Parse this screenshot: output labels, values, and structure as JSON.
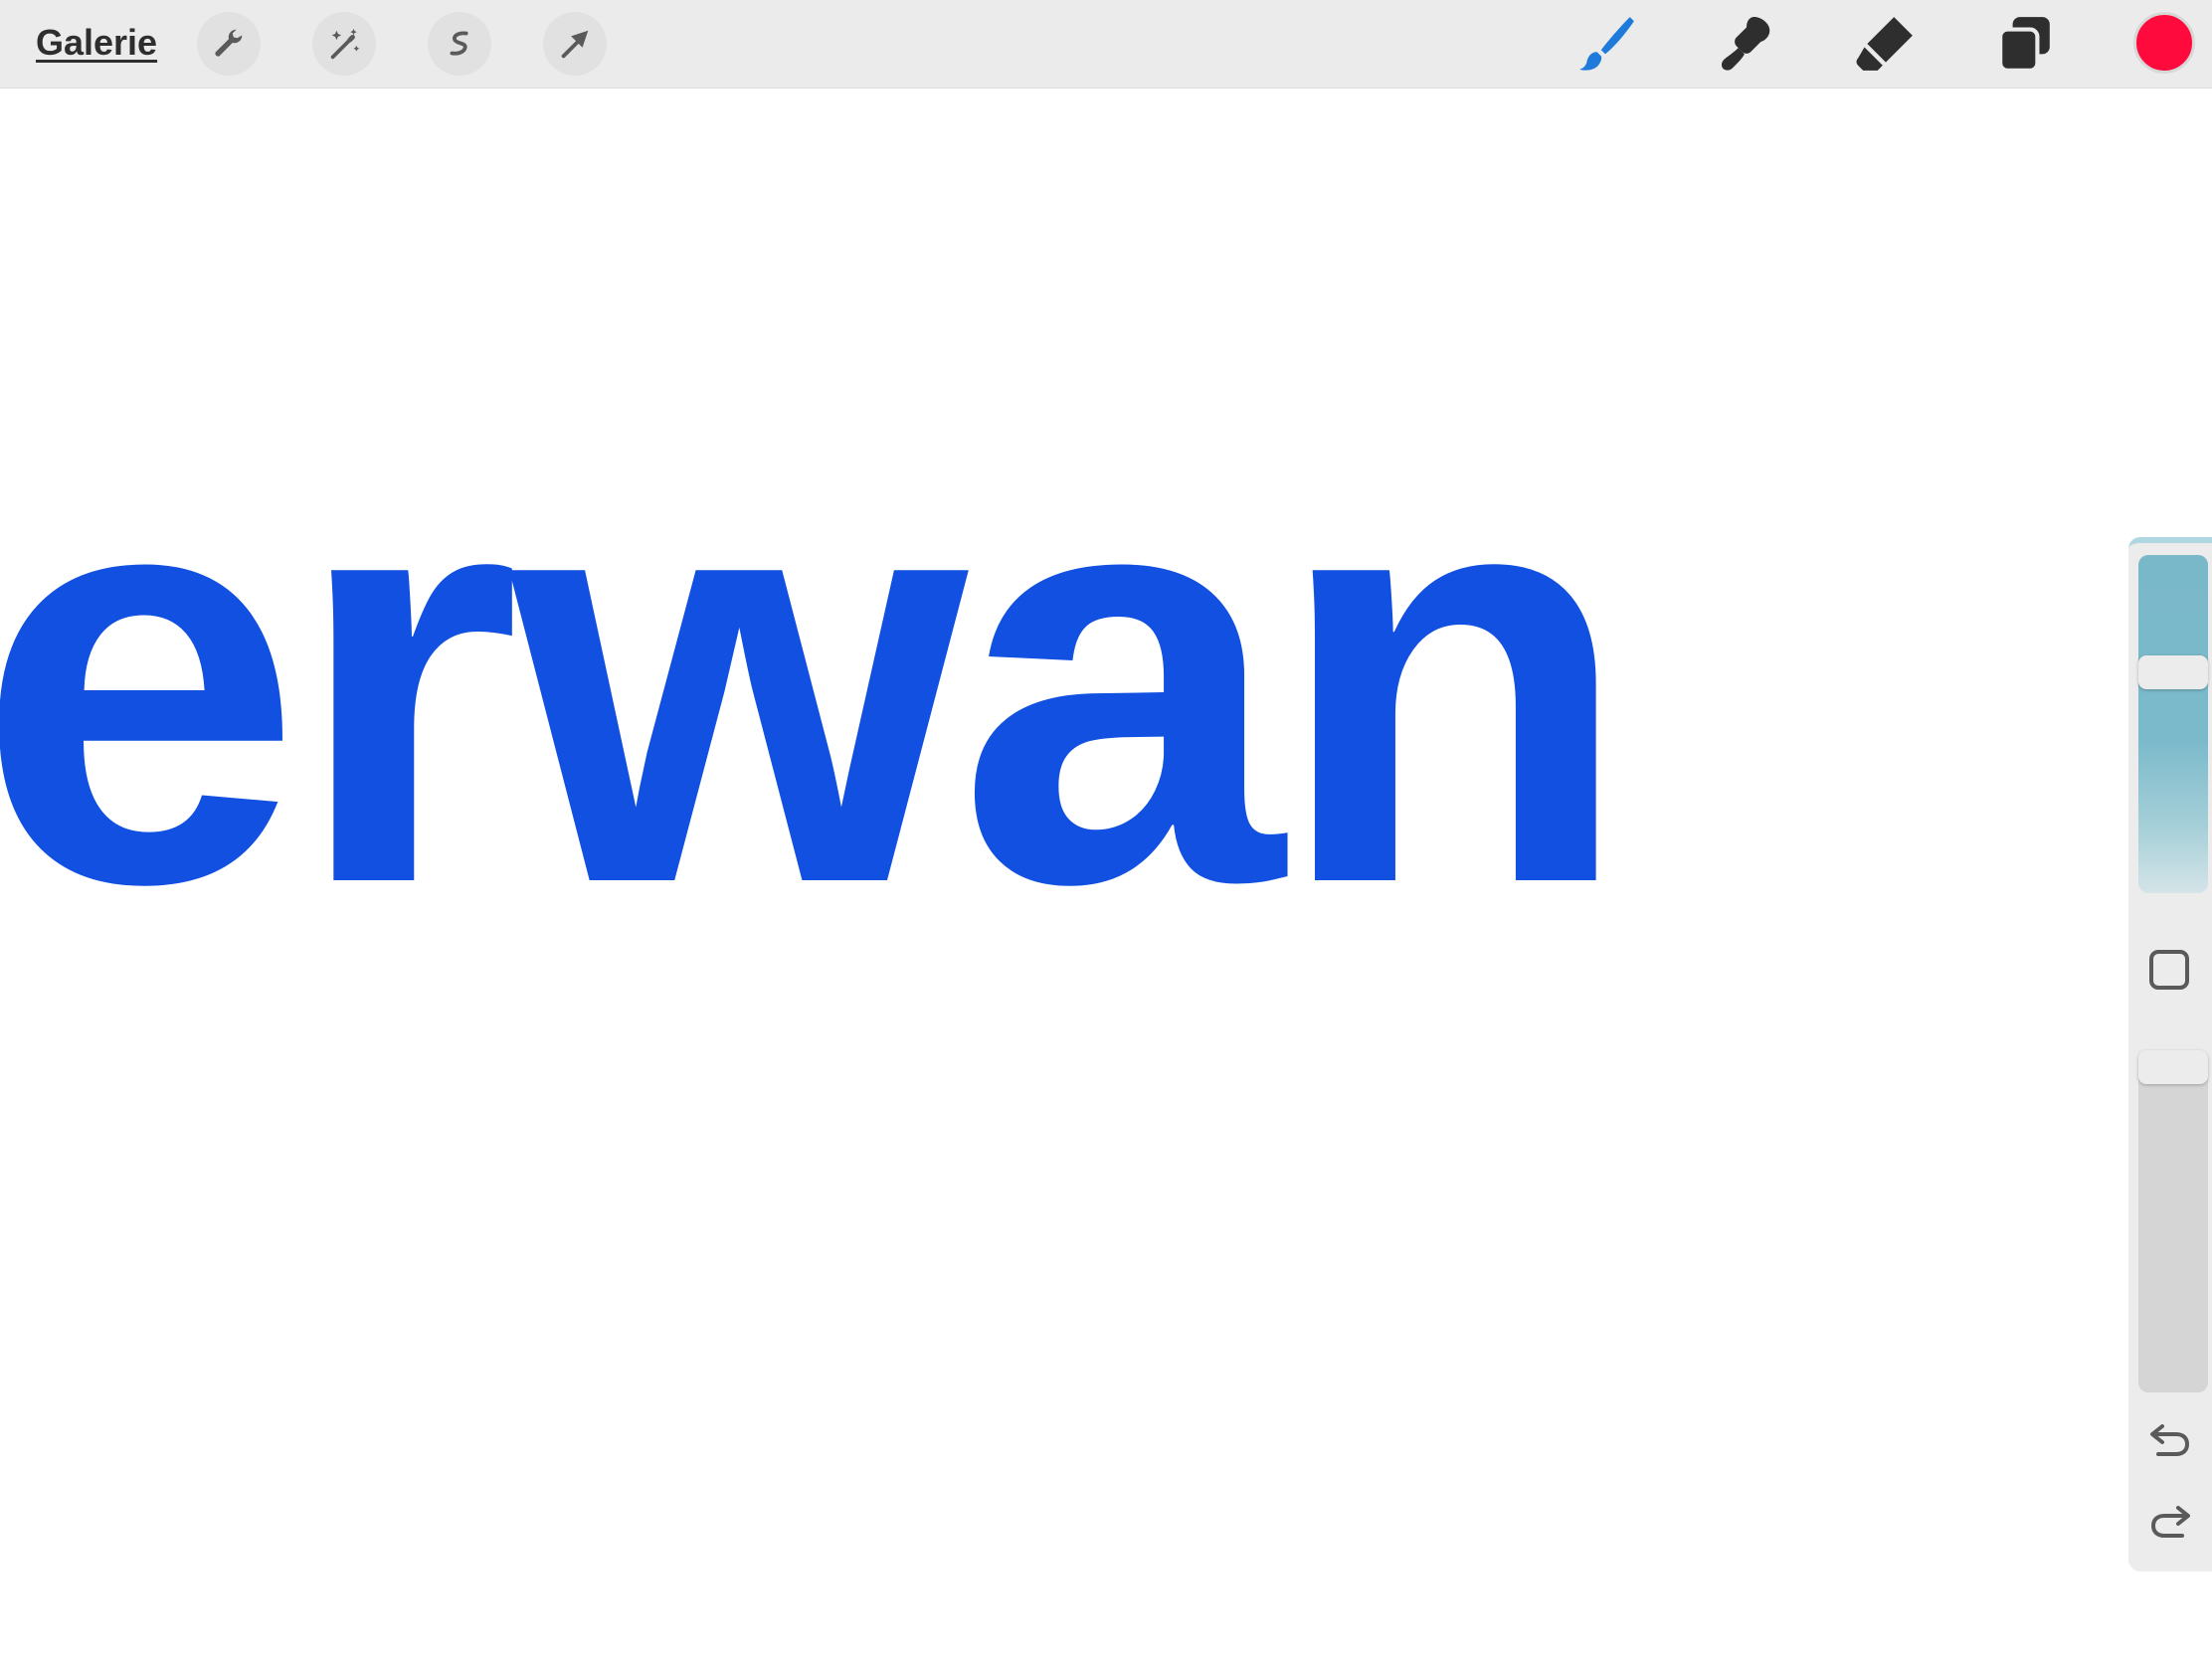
{
  "toolbar": {
    "gallery_label": "Galerie",
    "left_tools": [
      "wrench-icon",
      "magic-wand-icon",
      "selection-icon",
      "transform-arrow-icon"
    ],
    "right_tools": [
      "brush-icon",
      "smudge-icon",
      "eraser-icon",
      "layers-icon"
    ],
    "active_tool": "brush-icon",
    "active_color": "#ff0a3c"
  },
  "canvas": {
    "text": "erwan",
    "text_color": "#1150e0",
    "background": "#ffffff"
  },
  "sidebar": {
    "brush_size_level": 0.67,
    "opacity_level": 1.0,
    "icons": [
      "modify-square-icon",
      "undo-icon",
      "redo-icon"
    ]
  },
  "colors": {
    "toolbar_bg": "#ebebeb",
    "accent": "#1e7bdc",
    "icon_dark": "#2e2e2e"
  }
}
